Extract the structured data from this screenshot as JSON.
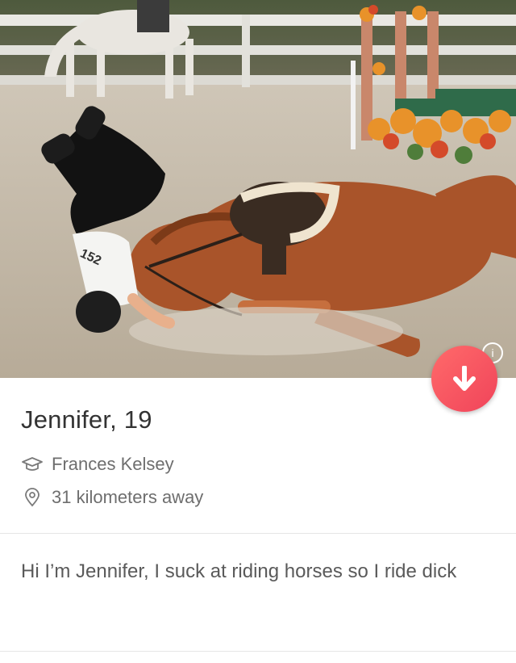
{
  "profile": {
    "name_age": "Jennifer, 19",
    "school": "Frances Kelsey",
    "distance": "31 kilometers away",
    "bio": "Hi I’m Jennifer, I suck at riding horses so I ride dick"
  },
  "photo": {
    "rider_number": "152"
  },
  "icons": {
    "school": "graduation-cap-icon",
    "location": "location-pin-icon",
    "collapse": "arrow-down-icon",
    "info": "info-icon"
  },
  "colors": {
    "accent": "#f0445a",
    "text_primary": "#333333",
    "text_secondary": "#6e6e6e"
  }
}
